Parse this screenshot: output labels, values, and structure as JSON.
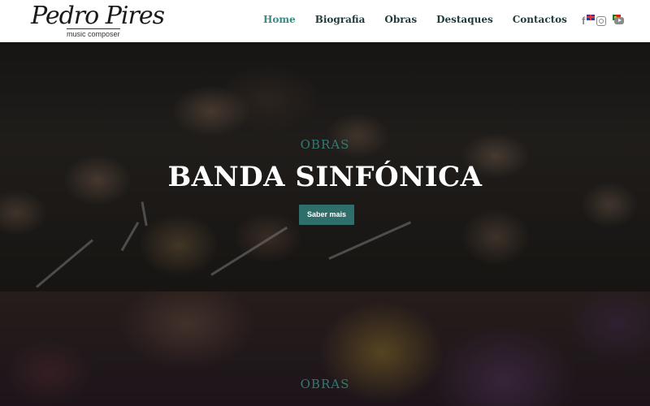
{
  "brand": {
    "name": "Pedro Pires",
    "tagline": "music composer"
  },
  "nav": {
    "items": [
      {
        "label": "Home",
        "active": true
      },
      {
        "label": "Biografia",
        "active": false
      },
      {
        "label": "Obras",
        "active": false
      },
      {
        "label": "Destaques",
        "active": false
      },
      {
        "label": "Contactos",
        "active": false
      }
    ],
    "languages": [
      "uk-flag-icon",
      "pt-flag-icon"
    ]
  },
  "social": [
    "facebook-icon",
    "instagram-icon",
    "youtube-icon"
  ],
  "hero": {
    "eyebrow": "OBRAS",
    "title": "BANDA SINFÓNICA",
    "button_label": "Saber mais"
  },
  "second_section": {
    "eyebrow": "OBRAS"
  },
  "colors": {
    "accent": "#2f7b74",
    "button": "#2e6f6b",
    "nav_text": "#1f3b3a",
    "nav_active": "#3a8a84"
  }
}
